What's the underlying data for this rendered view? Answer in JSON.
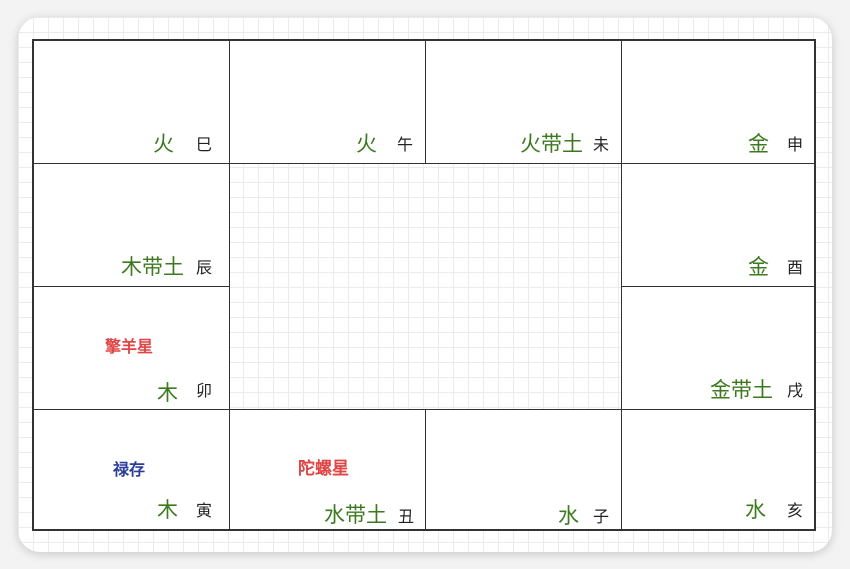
{
  "colors": {
    "element": "#3d7a1f",
    "branch": "#222222",
    "star_red": "#e04545",
    "star_blue": "#2b3d9a"
  },
  "cells": {
    "si": {
      "element": "火",
      "branch": "巳"
    },
    "wu": {
      "element": "火",
      "branch": "午"
    },
    "wei": {
      "element": "火带土",
      "branch": "未"
    },
    "shen": {
      "element": "金",
      "branch": "申"
    },
    "chen": {
      "element": "木带土",
      "branch": "辰"
    },
    "you": {
      "element": "金",
      "branch": "酉"
    },
    "mao": {
      "element": "木",
      "branch": "卯",
      "star": "擎羊星"
    },
    "xu": {
      "element": "金带土",
      "branch": "戌"
    },
    "yin": {
      "element": "木",
      "branch": "寅",
      "star": "禄存"
    },
    "chou": {
      "element": "水带土",
      "branch": "丑",
      "star": "陀螺星"
    },
    "zi": {
      "element": "水",
      "branch": "子"
    },
    "hai": {
      "element": "水",
      "branch": "亥"
    }
  }
}
